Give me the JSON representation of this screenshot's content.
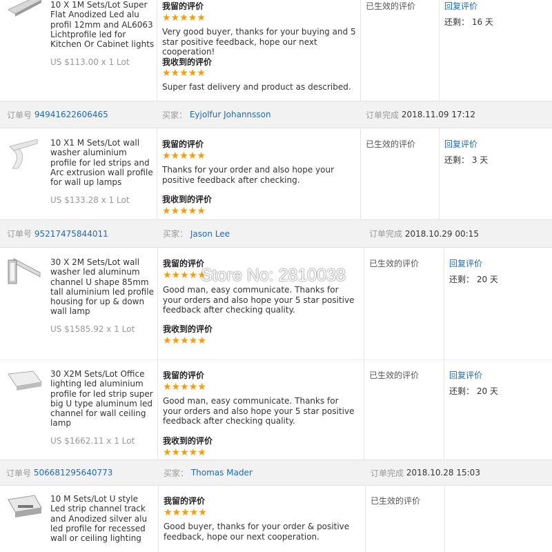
{
  "labels": {
    "order_no": "订单号",
    "buyer": "买家：",
    "order_done": "订单完成",
    "my_review": "我留的评价",
    "received_review": "我收到的评价",
    "status_effective": "已生效的评价",
    "reply": "回复评价",
    "remain_prefix": "还剩："
  },
  "stars": "★★★★★",
  "watermark": "Store No: 2810038",
  "items": [
    {
      "title": "10 X 1M Sets/Lot Super Flat Anodized Led alu profil 12mm and AL6063 Lichtprofile led for Kitchen Or Cabinet lights",
      "price": "US $113.00 x 1 Lot",
      "my_feedback": "Very good buyer, thanks for your buying and 5 star positive feedback, hope our next cooperation!",
      "received_feedback": "Super fast delivery and product as described.",
      "remain": "16 天"
    },
    {
      "title": "10 X1 M Sets/Lot wall washer aluminium profile for led strips and Arc extrusion wall profile for wall up lamps",
      "price": "US $133.28 x 1 Lot",
      "my_feedback": "Thanks for your order and also hope your positive feedback after checking.",
      "received_feedback": "",
      "remain": "3 天"
    },
    {
      "title": "30 X 2M Sets/Lot wall washer led aluminum channel U shape 85mm tall aluminium led profile housing for up & down wall lamp",
      "price": "US $1585.92 x 1 Lot",
      "my_feedback": "Good man, easy communicate. Thanks for your orders and also hope your 5 star positive feedback after checking quality.",
      "received_feedback": "",
      "remain": "20 天"
    },
    {
      "title": "30 X2M Sets/Lot Office lighting led aluminium profile for led strip super big U type aluminum led channel for wall ceiling lamp",
      "price": "US $1662.11 x 1 Lot",
      "my_feedback": "Good man, easy communicate. Thanks for your orders and also hope your 5 star positive feedback after checking quality.",
      "received_feedback": "",
      "remain": "20 天"
    },
    {
      "title": "10 M Sets/Lot U style Led strip channel track and Anodized silver alu led profile for recessed wall or ceiling lighting",
      "price": "",
      "my_feedback": "Good buyer, thanks for your order & positive feedback, hope our next cooperation.",
      "received_feedback": "",
      "remain": ""
    }
  ],
  "orders": [
    {
      "order_id": "94941622606465",
      "buyer": "Eyjolfur Johannsson",
      "completed": "2018.11.09 17:12"
    },
    {
      "order_id": "95217475844011",
      "buyer": "Jason Lee",
      "completed": "2018.10.29 00:15"
    },
    {
      "order_id": "506681295640773",
      "buyer": "Thomas Mader",
      "completed": "2018.10.28 15:03"
    }
  ]
}
